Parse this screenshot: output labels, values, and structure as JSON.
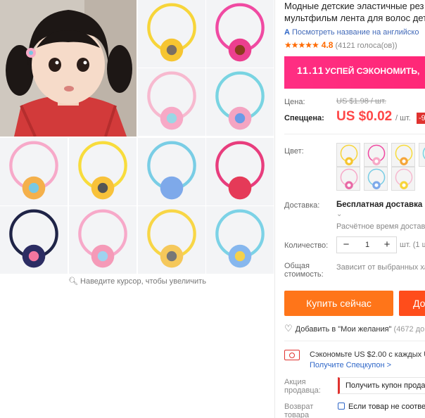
{
  "product": {
    "title_line1": "Модные детские эластичные рез",
    "title_line2": "мультфильм лента для волос дет",
    "translate_link": "Посмотреть название на английско",
    "translate_icon": "A",
    "rating_stars": "★★★★★",
    "rating_score": "4.8",
    "rating_votes": "(4121 голоса(ов))"
  },
  "promo_banner": {
    "event": "11.11",
    "text": "УСПЕЙ СЭКОНОМИТЬ,",
    "color": "#ff2e83"
  },
  "gallery": {
    "zoom_hint": "Наведите курсор, чтобы увеличить",
    "tiles": [
      {
        "name": "tile-yellow-sunflower",
        "ring": "#f7d53a",
        "charm": "#f6c531",
        "center": "#7a6f63"
      },
      {
        "name": "tile-pink-daisy",
        "ring": "#f04aa2",
        "charm": "#ec3f8f",
        "center": "#8b3b1d"
      },
      {
        "name": "tile-pink-flower",
        "ring": "#f7b9cf",
        "charm": "#f7a9c6",
        "center": "#9ad7e5"
      },
      {
        "name": "tile-blue-flower",
        "ring": "#79d4e2",
        "charm": "#f4a4c2",
        "center": "#6a9be7"
      },
      {
        "name": "tile-pink-ring-blue-ball",
        "ring": "#f7a9c9",
        "charm": "#f4b04b",
        "center": "#79c8e3"
      },
      {
        "name": "tile-yellow-mouse",
        "ring": "#f8dc3c",
        "charm": "#f8c23a",
        "center": "#555"
      },
      {
        "name": "tile-blue-bow",
        "ring": "#79cde5",
        "charm": "#7ea9ea",
        "center": "#7ea9ea"
      },
      {
        "name": "tile-red-bow",
        "ring": "#e83d7d",
        "charm": "#e53a58",
        "center": "#e53a58"
      },
      {
        "name": "tile-navy-mouse",
        "ring": "#1f2447",
        "charm": "#2c2d63",
        "center": "#f2769f"
      },
      {
        "name": "tile-pink-bunny",
        "ring": "#f7a9c9",
        "charm": "#f59ab8",
        "center": "#9fd3ef"
      },
      {
        "name": "tile-yellow-bunny",
        "ring": "#f8d646",
        "charm": "#f5c85b",
        "center": "#777"
      },
      {
        "name": "tile-blue-bunny",
        "ring": "#7cd2e6",
        "charm": "#86b7ee",
        "center": "#f4d14b"
      }
    ]
  },
  "pricing": {
    "price_label": "Цена:",
    "price_old": "US $1.98 / шт.",
    "special_label": "Спеццена:",
    "price_new": "US $0.02",
    "per_unit": "/ шт.",
    "discount": "-9"
  },
  "color": {
    "label": "Цвет:",
    "swatches": [
      {
        "name": "swatch-1",
        "ring": "#f7d53a",
        "charm": "#f6c531"
      },
      {
        "name": "swatch-2",
        "ring": "#f04aa2",
        "charm": "#f7a9c6"
      },
      {
        "name": "swatch-3",
        "ring": "#f8dc3c",
        "charm": "#f5a53a"
      },
      {
        "name": "swatch-4",
        "ring": "#79d4e2",
        "charm": "#6a9be7"
      },
      {
        "name": "swatch-5",
        "ring": "#f7a9c9",
        "charm": "#e86aa6"
      },
      {
        "name": "swatch-6",
        "ring": "#79cde5",
        "charm": "#7ea9ea"
      },
      {
        "name": "swatch-7",
        "ring": "#f7b9cf",
        "charm": "#f7d53a"
      }
    ]
  },
  "shipping": {
    "label": "Доставка:",
    "main": "Бесплатная доставка в Р",
    "estimate": "Расчётное время доставк"
  },
  "quantity": {
    "label": "Количество:",
    "value": "1",
    "minus": "−",
    "plus": "+",
    "unit_note": "шт. (1 ш"
  },
  "total": {
    "label_line1": "Общая",
    "label_line2": "стоимость:",
    "note": "Зависит от выбранных ха"
  },
  "actions": {
    "buy_now": "Купить сейчас",
    "add_to_cart": "До",
    "wishlist": "Добавить в \"Мои желания\"",
    "wishlist_count": "(4672 до"
  },
  "coupon": {
    "text": "Сэкономьте US $2.00 с каждых US",
    "link": "Получите Спецкупон >"
  },
  "seller_promo": {
    "label_line1": "Акция",
    "label_line2": "продавца:",
    "button": "Получить купон прода"
  },
  "returns": {
    "label_line1": "Возврат",
    "label_line2": "товара",
    "text": "Если товар не соответ"
  }
}
